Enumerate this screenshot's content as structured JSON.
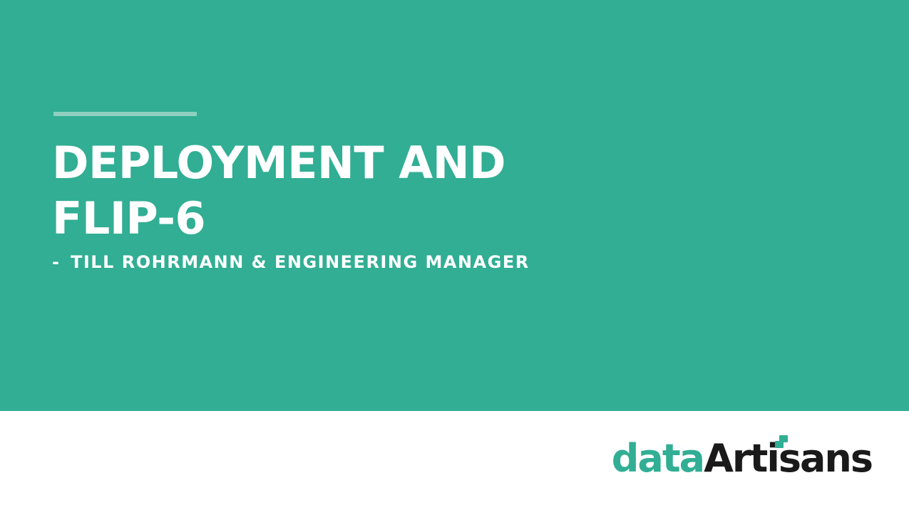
{
  "slide": {
    "title_line1": "DEPLOYMENT AND",
    "title_line2": "FLIP-6",
    "subtitle_dash": "-",
    "subtitle": "TILL ROHRMANN & ENGINEERING MANAGER"
  },
  "logo": {
    "part1": "data",
    "part2": "Artisans",
    "icon": "stacked-squares-logo-icon"
  },
  "colors": {
    "hero_background": "#31ae94",
    "accent_bar": "#8fd0c1",
    "logo_data": "#31ae94",
    "logo_artisans": "#1a1a1a"
  }
}
